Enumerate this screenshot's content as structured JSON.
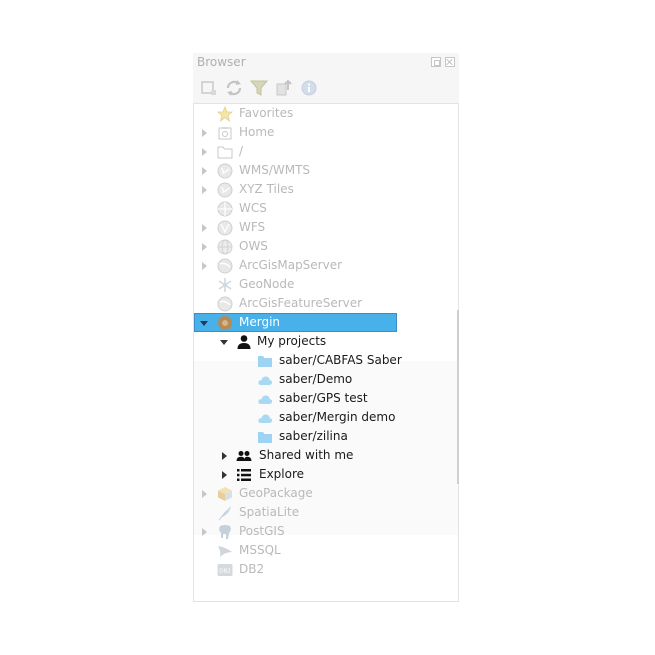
{
  "panel": {
    "title": "Browser"
  },
  "toolbar": {
    "buttons": [
      {
        "name": "add-layer-icon"
      },
      {
        "name": "refresh-icon"
      },
      {
        "name": "filter-icon"
      },
      {
        "name": "collapse-all-icon"
      },
      {
        "name": "properties-icon"
      }
    ]
  },
  "tree": {
    "items": [
      {
        "label": "Favorites",
        "icon": "star-icon"
      },
      {
        "label": "Home",
        "icon": "home-icon"
      },
      {
        "label": "/",
        "icon": "folder-icon"
      },
      {
        "label": "WMS/WMTS",
        "icon": "globe-icon"
      },
      {
        "label": "XYZ Tiles",
        "icon": "globe-icon"
      },
      {
        "label": "WCS",
        "icon": "globe-icon"
      },
      {
        "label": "WFS",
        "icon": "globe-icon"
      },
      {
        "label": "OWS",
        "icon": "globe-icon"
      },
      {
        "label": "ArcGisMapServer",
        "icon": "globe-icon"
      },
      {
        "label": "GeoNode",
        "icon": "geonode-icon"
      },
      {
        "label": "ArcGisFeatureServer",
        "icon": "globe-icon"
      },
      {
        "label": "Mergin",
        "icon": "mergin-icon"
      },
      {
        "label": "My projects",
        "icon": "user-icon"
      },
      {
        "label": "saber/CABFAS Saber",
        "icon": "folder-icon"
      },
      {
        "label": "saber/Demo",
        "icon": "cloud-icon"
      },
      {
        "label": "saber/GPS test",
        "icon": "cloud-icon"
      },
      {
        "label": "saber/Mergin demo",
        "icon": "cloud-icon"
      },
      {
        "label": "saber/zilina",
        "icon": "folder-icon"
      },
      {
        "label": "Shared with me",
        "icon": "users-icon"
      },
      {
        "label": "Explore",
        "icon": "list-icon"
      },
      {
        "label": "GeoPackage",
        "icon": "geopackage-icon"
      },
      {
        "label": "SpatiaLite",
        "icon": "feather-icon"
      },
      {
        "label": "PostGIS",
        "icon": "elephant-icon"
      },
      {
        "label": "MSSQL",
        "icon": "mssql-icon"
      },
      {
        "label": "DB2",
        "icon": "db2-icon"
      }
    ]
  },
  "colors": {
    "selection": "#48b1ea",
    "faded_text": "#b9b9b9",
    "folder": "#9fd3f3"
  }
}
